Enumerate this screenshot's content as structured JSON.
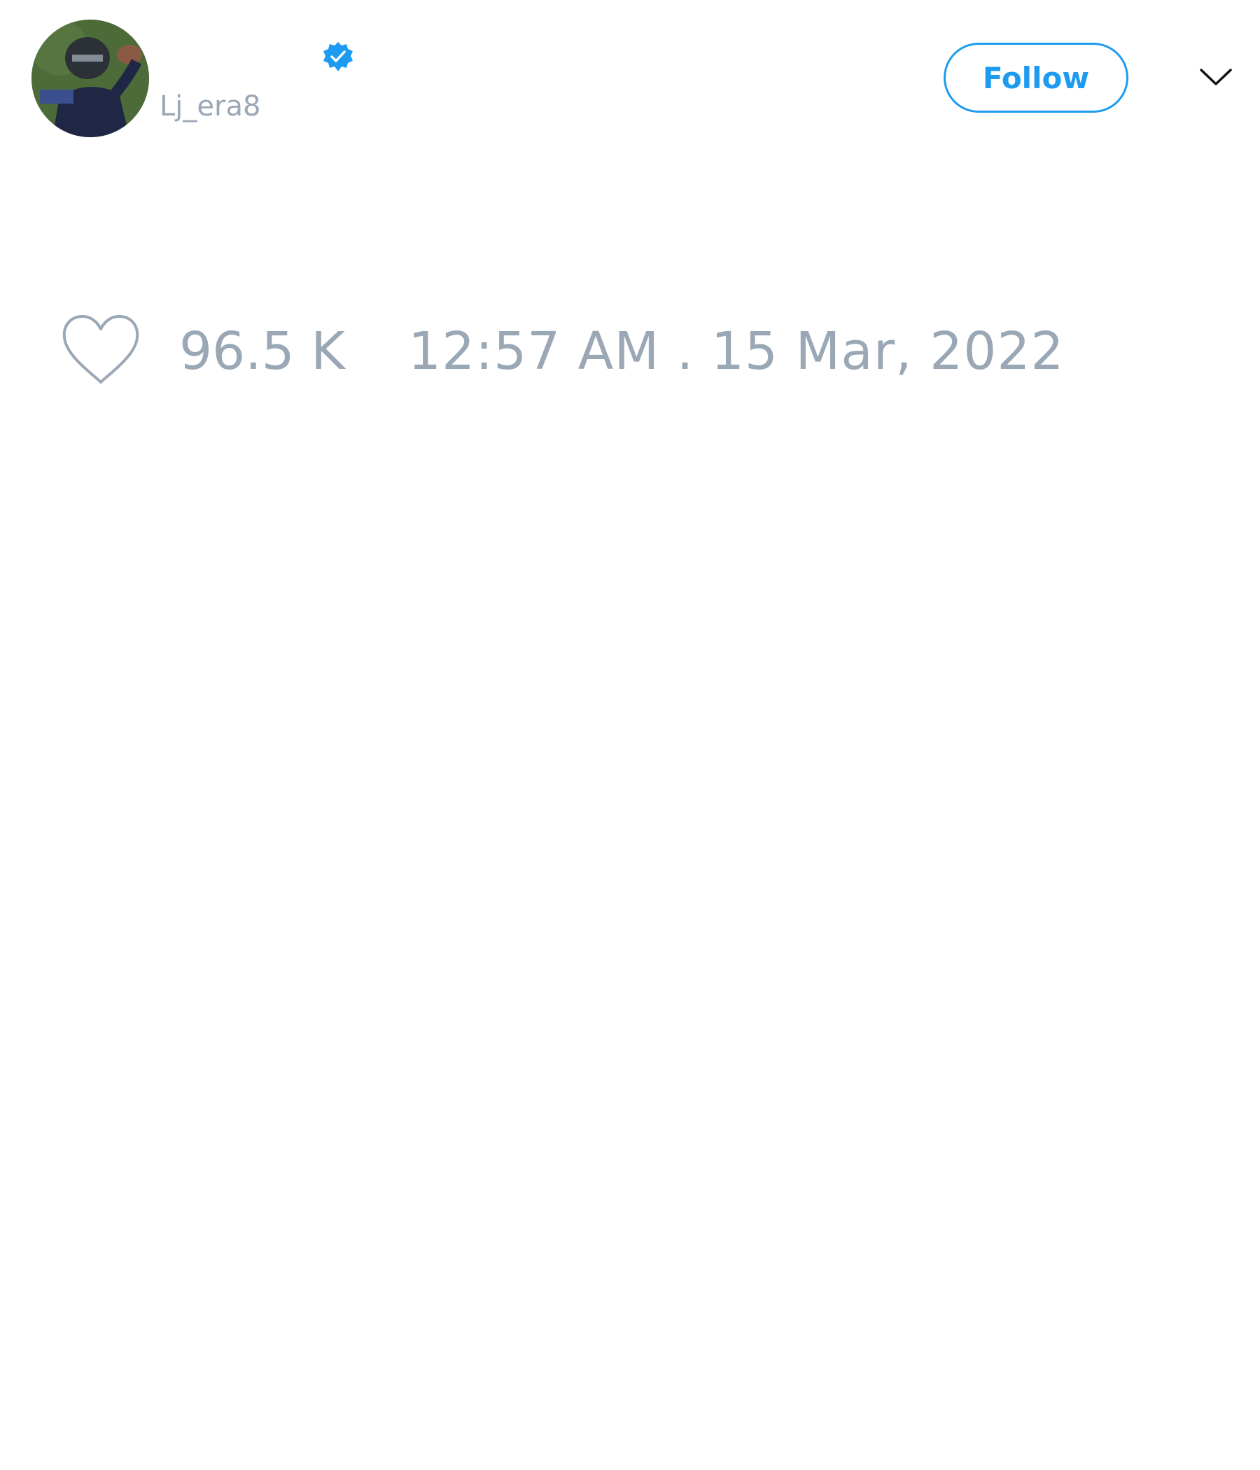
{
  "author": {
    "handle": "Lj_era8",
    "verified": true,
    "avatar_description_icon": "avatar-photo"
  },
  "actions": {
    "follow_label": "Follow",
    "more_icon": "chevron-down-icon"
  },
  "engagement": {
    "like_icon": "heart-outline-icon",
    "like_count": "96.5 K"
  },
  "meta": {
    "timestamp": "12:57 AM . 15 Mar, 2022"
  },
  "colors": {
    "accent": "#1d9bf0",
    "muted_text": "#9aa7b5",
    "background": "#ffffff"
  }
}
